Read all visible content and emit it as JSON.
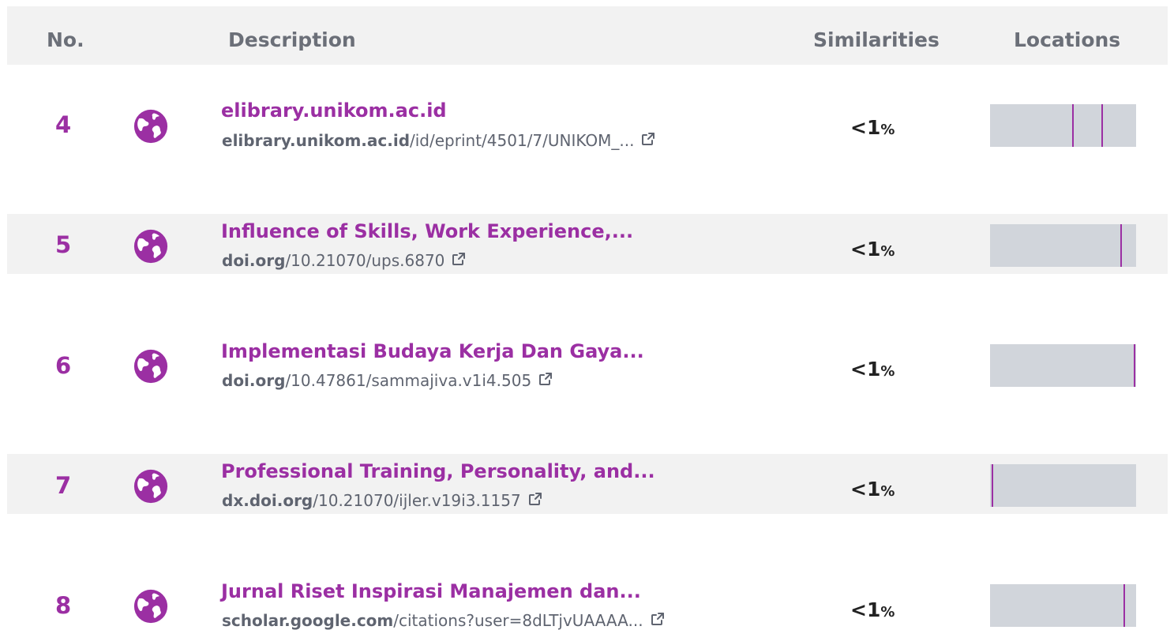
{
  "header": {
    "no": "No.",
    "description": "Description",
    "similarities": "Similarities",
    "locations": "Locations"
  },
  "colors": {
    "accent": "#9b2fa3",
    "header_bg": "#f2f2f2",
    "bar_bg": "#d1d5db",
    "icon": "#9b2fa3"
  },
  "rows": [
    {
      "number": "4",
      "icon": "globe-icon",
      "title": "elibrary.unikom.ac.id",
      "url_domain": "elibrary.unikom.ac.id",
      "url_path": "/id/eprint/4501/7/UNIKOM_...",
      "similarity_value": "<1",
      "similarity_unit": "%",
      "location_markers": [
        0.56,
        0.76
      ]
    },
    {
      "number": "5",
      "icon": "globe-icon",
      "title": "Influence of Skills, Work Experience,...",
      "url_domain": "doi.org",
      "url_path": "/10.21070/ups.6870",
      "similarity_value": "<1",
      "similarity_unit": "%",
      "location_markers": [
        0.89
      ]
    },
    {
      "number": "6",
      "icon": "globe-icon",
      "title": "Implementasi Budaya Kerja Dan Gaya...",
      "url_domain": "doi.org",
      "url_path": "/10.47861/sammajiva.v1i4.505",
      "similarity_value": "<1",
      "similarity_unit": "%",
      "location_markers": [
        0.985
      ]
    },
    {
      "number": "7",
      "icon": "globe-icon",
      "title": "Professional Training, Personality, and...",
      "url_domain": "dx.doi.org",
      "url_path": "/10.21070/ijler.v19i3.1157",
      "similarity_value": "<1",
      "similarity_unit": "%",
      "location_markers": [
        0.01
      ]
    },
    {
      "number": "8",
      "icon": "globe-icon",
      "title": "Jurnal Riset Inspirasi Manajemen dan...",
      "url_domain": "scholar.google.com",
      "url_path": "/citations?user=8dLTjvUAAAA...",
      "similarity_value": "<1",
      "similarity_unit": "%",
      "location_markers": [
        0.915
      ]
    }
  ]
}
